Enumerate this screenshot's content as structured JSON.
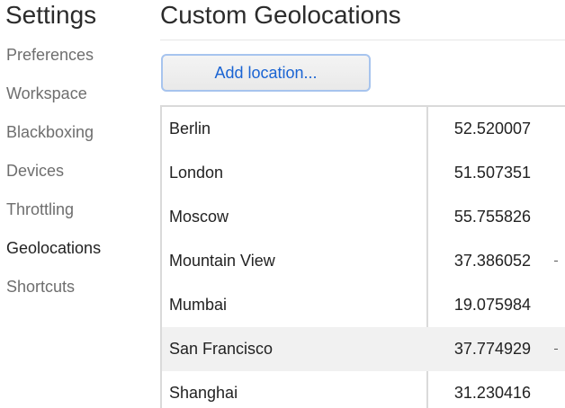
{
  "sidebar": {
    "title": "Settings",
    "items": [
      {
        "label": "Preferences",
        "active": false
      },
      {
        "label": "Workspace",
        "active": false
      },
      {
        "label": "Blackboxing",
        "active": false
      },
      {
        "label": "Devices",
        "active": false
      },
      {
        "label": "Throttling",
        "active": false
      },
      {
        "label": "Geolocations",
        "active": true
      },
      {
        "label": "Shortcuts",
        "active": false
      }
    ]
  },
  "main": {
    "title": "Custom Geolocations",
    "add_button_label": "Add location...",
    "locations": [
      {
        "name": "Berlin",
        "latitude": "52.520007"
      },
      {
        "name": "London",
        "latitude": "51.507351"
      },
      {
        "name": "Moscow",
        "latitude": "55.755826"
      },
      {
        "name": "Mountain View",
        "latitude": "37.386052"
      },
      {
        "name": "Mumbai",
        "latitude": "19.075984"
      },
      {
        "name": "San Francisco",
        "latitude": "37.774929"
      },
      {
        "name": "Shanghai",
        "latitude": "31.230416"
      }
    ]
  },
  "colors": {
    "accent": "#1a64d3",
    "button_border": "#a7c4ee",
    "hover_row": "#f1f1f1"
  }
}
